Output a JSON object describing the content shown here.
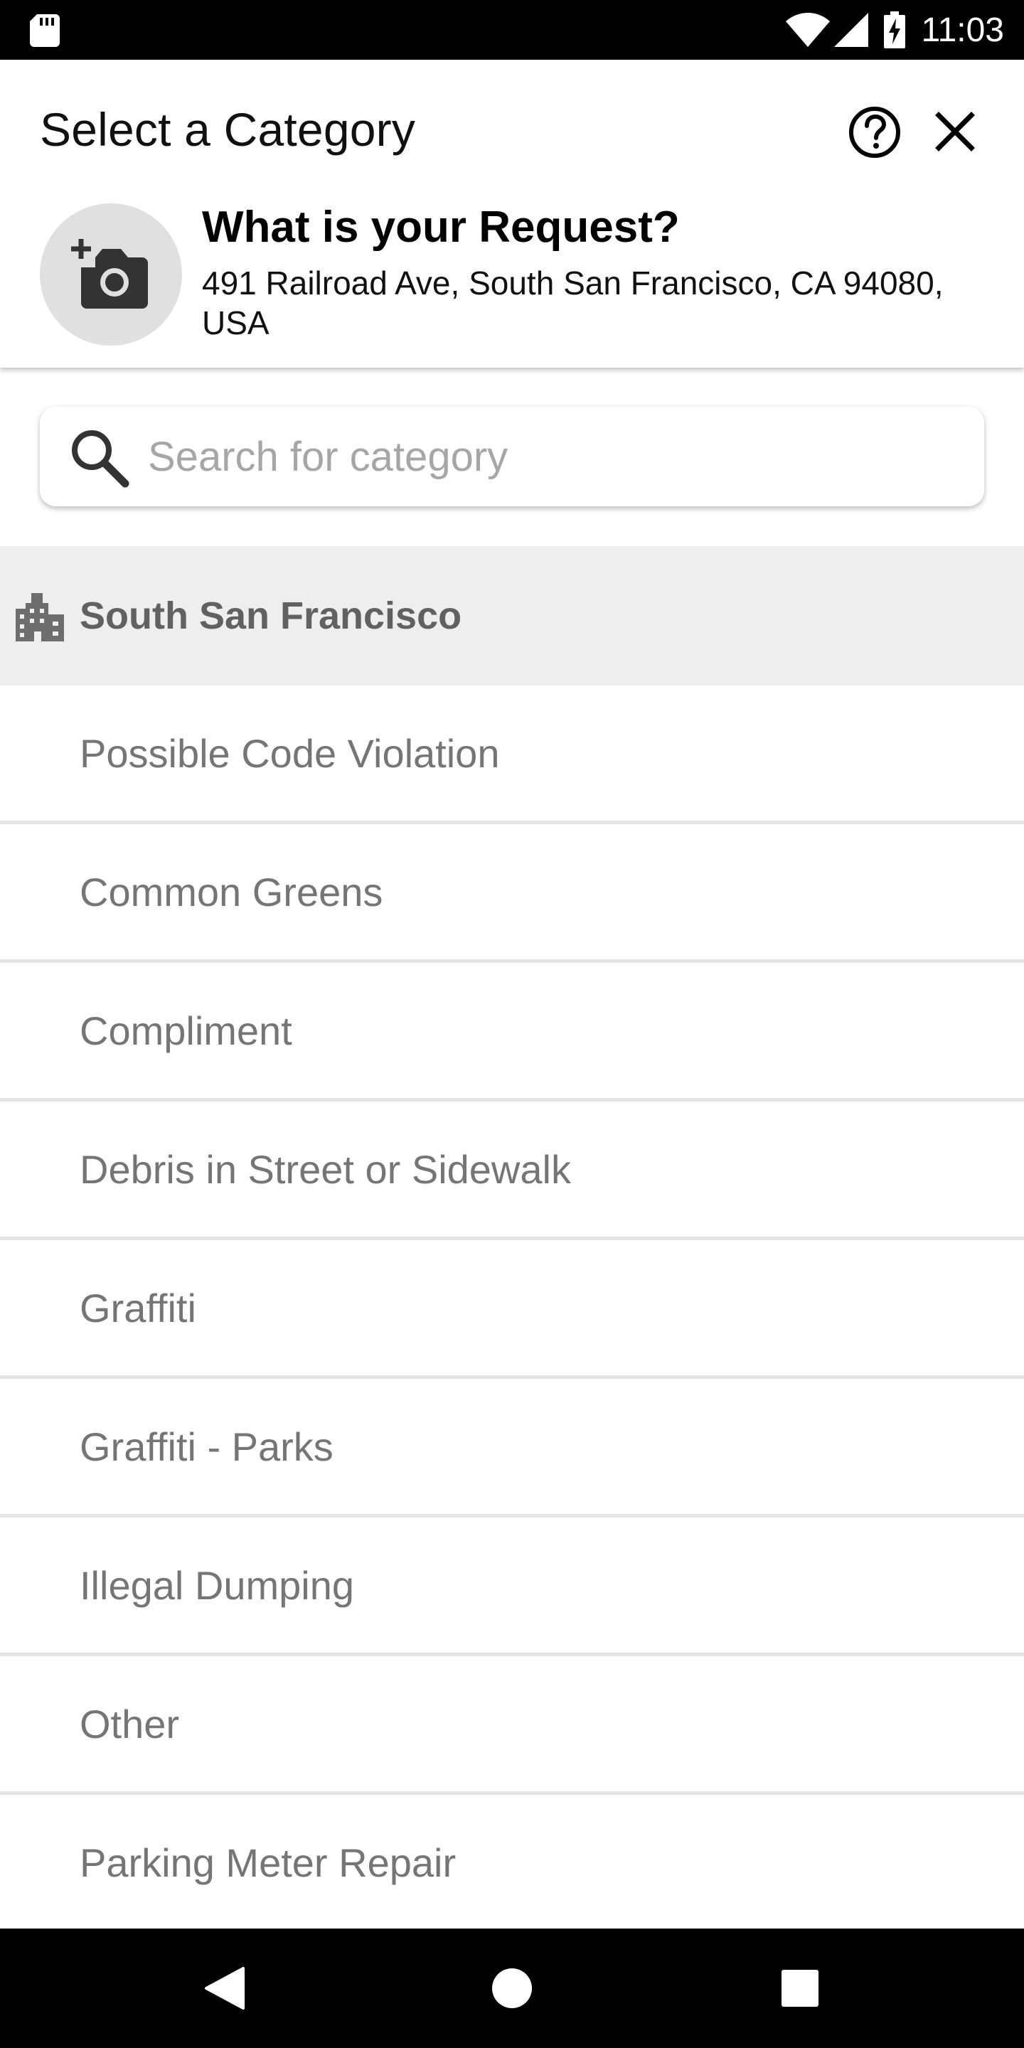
{
  "status_bar": {
    "time": "11:03",
    "icons": [
      "sd-card-icon",
      "wifi-icon",
      "signal-icon",
      "battery-charging-icon"
    ]
  },
  "header": {
    "title": "Select a Category",
    "help_icon": "help-circle-icon",
    "close_icon": "close-icon",
    "photo_icon": "add-photo-icon",
    "request_title": "What is your Request?",
    "address": "491 Railroad Ave, South San Francisco, CA 94080, USA"
  },
  "search": {
    "placeholder": "Search for category",
    "value": ""
  },
  "section": {
    "icon": "building-icon",
    "label": "South San Francisco"
  },
  "categories": [
    "Possible Code Violation",
    "Common Greens",
    "Compliment",
    "Debris in Street or Sidewalk",
    "Graffiti",
    "Graffiti - Parks",
    "Illegal Dumping",
    "Other",
    "Parking Meter Repair"
  ],
  "nav_bar": {
    "icons": [
      "back-icon",
      "home-icon",
      "recents-icon"
    ]
  },
  "colors": {
    "status_bar": "#000000",
    "section_bg": "#eeeeee",
    "section_text": "#616161",
    "item_text": "#757575",
    "photo_circle": "#e0e0e0"
  }
}
